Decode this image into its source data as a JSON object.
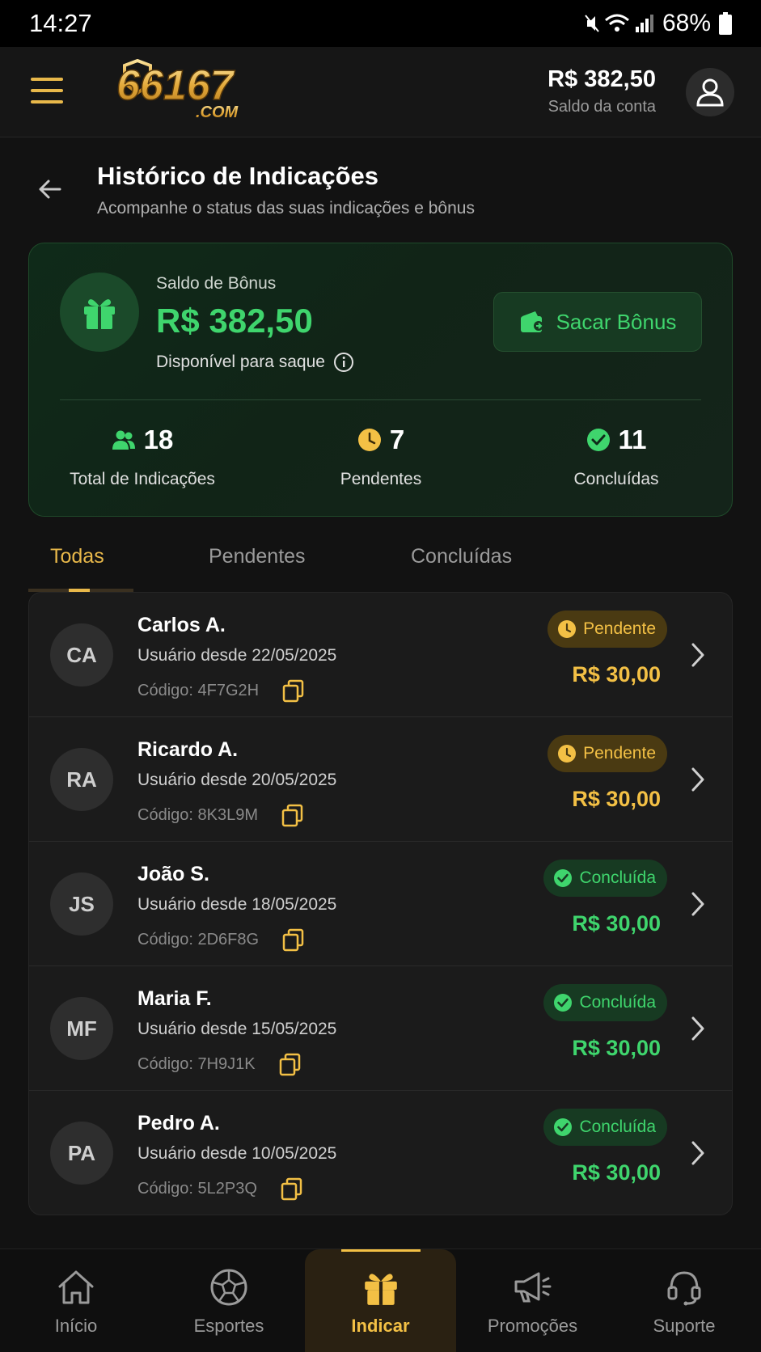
{
  "status_bar": {
    "time": "14:27",
    "battery": "68%"
  },
  "header": {
    "logo_text": "66167",
    "logo_sub": ".COM",
    "balance": "R$ 382,50",
    "balance_label": "Saldo da conta"
  },
  "page": {
    "title": "Histórico de Indicações",
    "subtitle": "Acompanhe o status das suas indicações e bônus"
  },
  "bonus": {
    "label": "Saldo de Bônus",
    "value": "R$ 382,50",
    "available": "Disponível para saque",
    "withdraw_label": "Sacar Bônus",
    "stats": [
      {
        "value": "18",
        "label": "Total de Indicações"
      },
      {
        "value": "7",
        "label": "Pendentes"
      },
      {
        "value": "11",
        "label": "Concluídas"
      }
    ]
  },
  "tabs": [
    "Todas",
    "Pendentes",
    "Concluídas"
  ],
  "referrals": [
    {
      "initials": "CA",
      "name": "Carlos A.",
      "since": "Usuário desde 22/05/2025",
      "code": "Código: 4F7G2H",
      "status": "Pendente",
      "status_type": "pending",
      "amount": "R$ 30,00"
    },
    {
      "initials": "RA",
      "name": "Ricardo A.",
      "since": "Usuário desde 20/05/2025",
      "code": "Código: 8K3L9M",
      "status": "Pendente",
      "status_type": "pending",
      "amount": "R$ 30,00"
    },
    {
      "initials": "JS",
      "name": "João S.",
      "since": "Usuário desde 18/05/2025",
      "code": "Código: 2D6F8G",
      "status": "Concluída",
      "status_type": "done",
      "amount": "R$ 30,00"
    },
    {
      "initials": "MF",
      "name": "Maria F.",
      "since": "Usuário desde 15/05/2025",
      "code": "Código: 7H9J1K",
      "status": "Concluída",
      "status_type": "done",
      "amount": "R$ 30,00"
    },
    {
      "initials": "PA",
      "name": "Pedro A.",
      "since": "Usuário desde 10/05/2025",
      "code": "Código: 5L2P3Q",
      "status": "Concluída",
      "status_type": "done",
      "amount": "R$ 30,00"
    }
  ],
  "bottom_nav": [
    {
      "label": "Início",
      "icon": "home-icon"
    },
    {
      "label": "Esportes",
      "icon": "soccer-ball-icon"
    },
    {
      "label": "Indicar",
      "icon": "gift-icon"
    },
    {
      "label": "Promoções",
      "icon": "megaphone-icon"
    },
    {
      "label": "Suporte",
      "icon": "headset-icon"
    }
  ],
  "colors": {
    "accent_gold": "#e8b84a",
    "success_green": "#3fd56d",
    "pending_yellow": "#f3c045",
    "background": "#121212"
  }
}
